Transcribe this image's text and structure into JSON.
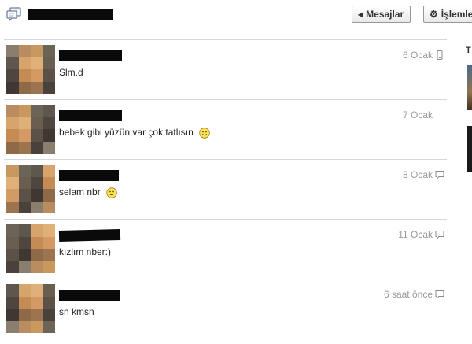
{
  "header": {
    "back_button": "Mesajlar",
    "actions_button": "İşlemler"
  },
  "sidebar": {
    "label": "T"
  },
  "conversations": [
    {
      "message": "Slm.d",
      "date": "6 Ocak",
      "has_smiley": false,
      "device_icon": "mobile-icon"
    },
    {
      "message": "bebek gibi yüzün var çok tatlısın",
      "date": "7 Ocak",
      "has_smiley": true,
      "device_icon": "none"
    },
    {
      "message": "selam nbr",
      "date": "8 Ocak",
      "has_smiley": true,
      "device_icon": "chat-bubble-icon"
    },
    {
      "message": "kızlım nber:)",
      "date": "11 Ocak",
      "has_smiley": false,
      "device_icon": "chat-bubble-icon"
    },
    {
      "message": "sn kmsn",
      "date": "6 saat önce",
      "has_smiley": false,
      "device_icon": "chat-bubble-icon"
    }
  ],
  "colors": {
    "divider": "#d7d7d7",
    "date_text": "#999999",
    "message_text": "#222222",
    "redaction": "#0a0a0a"
  }
}
